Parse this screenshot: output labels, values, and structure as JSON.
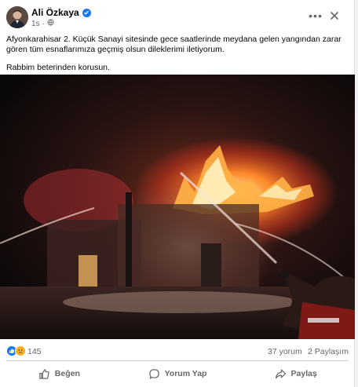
{
  "post": {
    "author": "Ali Özkaya",
    "timestamp": "1s",
    "privacy_icon": "globe-icon",
    "verified_icon": "verified-badge-icon",
    "paragraphs": [
      "Afyonkarahisar 2. Küçük Sanayi sitesinde gece saatlerinde meydana gelen yangından zarar gören tüm esnaflarımıza geçmiş olsun dileklerimi iletiyorum.",
      "Rabbim beterinden korusun."
    ]
  },
  "stats": {
    "reaction_icons": [
      "like-icon",
      "sad-icon"
    ],
    "reaction_count": "145",
    "comments": "37 yorum",
    "shares": "2 Paylaşım"
  },
  "actions": {
    "like": "Beğen",
    "comment": "Yorum Yap",
    "share": "Paylaş"
  },
  "colors": {
    "accent": "#1877f2",
    "secondary_text": "#65676b",
    "fire": "#ff7a1a"
  }
}
